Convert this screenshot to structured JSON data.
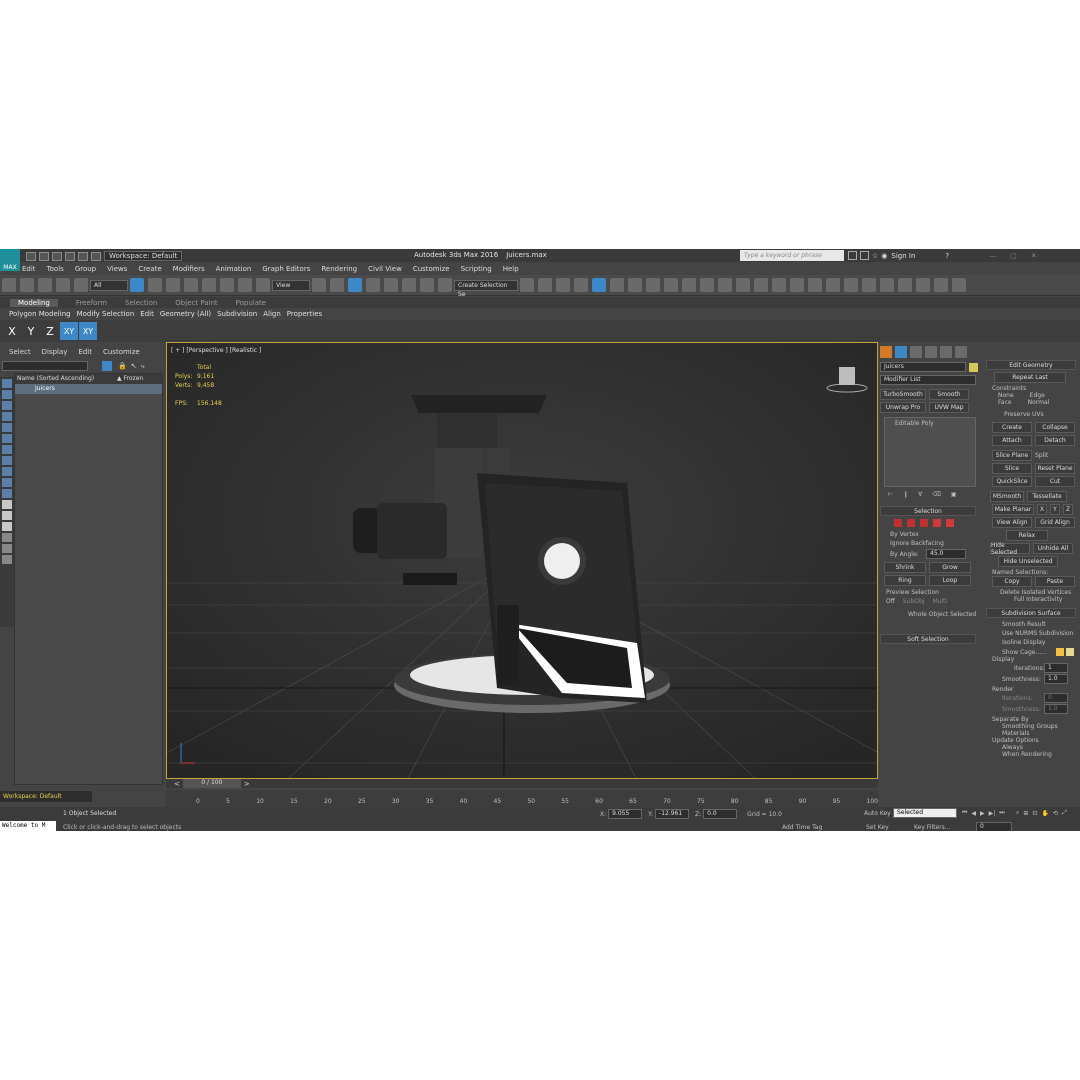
{
  "titlebar": {
    "app_title": "Autodesk 3ds Max 2016",
    "file_name": "Juicers.max",
    "logo_text": "MAX",
    "workspace": "Workspace: Default",
    "search_placeholder": "Type a keyword or phrase",
    "sign_in": "Sign In"
  },
  "menu": [
    "Edit",
    "Tools",
    "Group",
    "Views",
    "Create",
    "Modifiers",
    "Animation",
    "Graph Editors",
    "Rendering",
    "Civil View",
    "Customize",
    "Scripting",
    "Help"
  ],
  "toolbar": {
    "filter_value": "All",
    "ref_coord": "View",
    "selection_set_placeholder": "Create Selection Se"
  },
  "ribbon": {
    "tabs": [
      "Modeling",
      "Freeform",
      "Selection",
      "Object Paint",
      "Populate"
    ],
    "sub": [
      "Polygon Modeling",
      "Modify Selection",
      "Edit",
      "Geometry (All)",
      "Subdivision",
      "Align",
      "Properties"
    ]
  },
  "axes": [
    "X",
    "Y",
    "Z",
    "XY",
    "XY"
  ],
  "scene_explorer": {
    "tabs": [
      "Select",
      "Display",
      "Edit",
      "Customize"
    ],
    "col_name": "Name (Sorted Ascending)",
    "col_frozen": "▲ Frozen",
    "object": "Juicers",
    "workspace": "Workspace: Default"
  },
  "viewport": {
    "label": "[ + ] [Perspective ] [Realistic ]",
    "total_label": "Total",
    "polys_label": "Polys:",
    "polys_value": "9,161",
    "verts_label": "Verts:",
    "verts_value": "9,458",
    "fps_label": "FPS:",
    "fps_value": "156.148"
  },
  "command_panel": {
    "object_name": "Juicers",
    "modifier_list": "Modifier List",
    "buttons": [
      "TurboSmooth",
      "Smooth",
      "Unwrap Pro",
      "UVW Map"
    ],
    "stack_item": "Editable Poly",
    "selection_title": "Selection",
    "by_vertex": "By Vertex",
    "ignore_backfacing": "Ignore Backfacing",
    "by_angle": "By Angle:",
    "angle_value": "45.0",
    "shrink": "Shrink",
    "grow": "Grow",
    "ring": "Ring",
    "loop": "Loop",
    "preview_selection": "Preview Selection",
    "off": "Off",
    "subobj": "SubObj",
    "multi": "Multi",
    "whole_object": "Whole Object Selected",
    "soft_selection": "Soft Selection",
    "accent_color": "#d7c85a"
  },
  "edit_geometry": {
    "title": "Edit Geometry",
    "repeat_last": "Repeat Last",
    "constraints": "Constraints",
    "none": "None",
    "edge": "Edge",
    "face": "Face",
    "normal": "Normal",
    "preserve_uvs": "Preserve UVs",
    "create": "Create",
    "collapse": "Collapse",
    "attach": "Attach",
    "detach": "Detach",
    "slice_plane": "Slice Plane",
    "split": "Split",
    "slice": "Slice",
    "reset_plane": "Reset Plane",
    "quickslice": "QuickSlice",
    "cut": "Cut",
    "msmooth": "MSmooth",
    "tessellate": "Tessellate",
    "make_planar": "Make Planar",
    "x": "X",
    "y": "Y",
    "z": "Z",
    "view_align": "View Align",
    "grid_align": "Grid Align",
    "relax": "Relax",
    "hide_selected": "Hide Selected",
    "unhide_all": "Unhide All",
    "hide_unselected": "Hide Unselected",
    "named_selections": "Named Selections:",
    "copy": "Copy",
    "paste": "Paste",
    "delete_isolated": "Delete Isolated Vertices",
    "full_interactivity": "Full Interactivity",
    "subdivision_surface": "Subdivision Surface",
    "smooth_result": "Smooth Result",
    "use_nurms": "Use NURMS Subdivision",
    "isoline": "Isoline Display",
    "show_cage": "Show Cage......",
    "display": "Display",
    "iterations": "Iterations:",
    "iter_value": "1",
    "smoothness": "Smoothness:",
    "smooth_value": "1.0",
    "render": "Render",
    "r_iterations": "Iterations:",
    "r_iter_value": "0",
    "r_smoothness": "Smoothness:",
    "r_smooth_value": "1.0",
    "separate_by": "Separate By",
    "smoothing_groups": "Smoothing Groups",
    "materials": "Materials",
    "update_options": "Update Options",
    "always": "Always",
    "when_rendering": "When Rendering",
    "cage_colors": [
      "#f0c040",
      "#e8d890"
    ]
  },
  "timeline": {
    "frame": "0 / 100",
    "ticks": [
      "0",
      "5",
      "10",
      "15",
      "20",
      "25",
      "30",
      "35",
      "40",
      "45",
      "50",
      "55",
      "60",
      "65",
      "70",
      "75",
      "80",
      "85",
      "90",
      "95",
      "100"
    ]
  },
  "status": {
    "maxscript": "Welcome to M",
    "selected": "1 Object Selected",
    "prompt": "Click or click-and-drag to select objects",
    "x_label": "X:",
    "x_value": "9.055",
    "y_label": "Y:",
    "y_value": "-12.961",
    "z_label": "Z:",
    "z_value": "0.0",
    "grid": "Grid = 10.0",
    "add_time_tag": "Add Time Tag",
    "auto_key": "Auto Key",
    "set_key": "Set Key",
    "selected_drop": "Selected",
    "key_filters": "Key Filters...",
    "frame_field": "0"
  }
}
